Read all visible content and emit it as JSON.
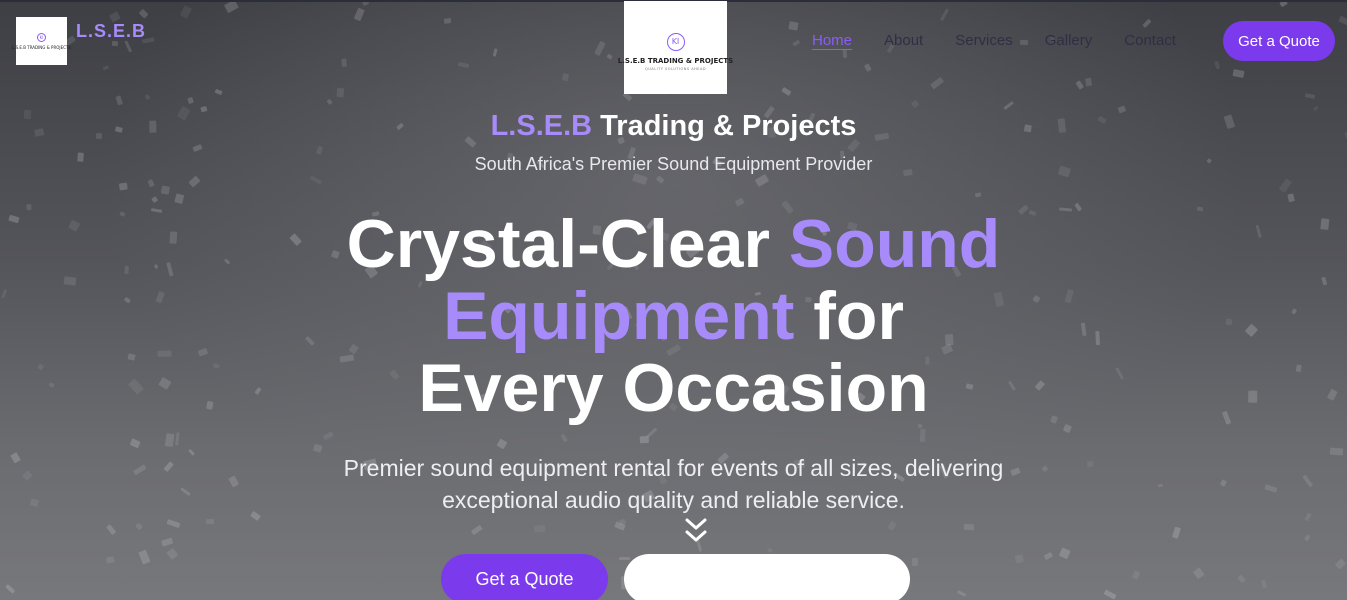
{
  "header": {
    "brand_name": "L.S.E.B",
    "brand_sub": "",
    "brand_logo_text": "L.S.E.B TRADING & PROJECTS",
    "center_logo_title": "L.S.E.B TRADING & PROJECTS",
    "center_logo_sub": "QUALITY SOLUTIONS AHEAD",
    "logo_monogram": "KI",
    "nav": [
      {
        "label": "Home",
        "active": true
      },
      {
        "label": "About",
        "active": false
      },
      {
        "label": "Services",
        "active": false
      },
      {
        "label": "Gallery",
        "active": false
      },
      {
        "label": "Contact",
        "active": false
      }
    ],
    "cta_label": "Get a Quote"
  },
  "hero": {
    "company_accent": "L.S.E.B",
    "company_rest": " Trading & Projects",
    "tagline": "South Africa's Premier Sound Equipment Provider",
    "headline_part1": "Crystal-Clear ",
    "headline_accent1": "Sound",
    "headline_accent2": "Equipment",
    "headline_part2": " for",
    "headline_part3": "Every Occasion",
    "description": "Premier sound equipment rental for events of all sizes, delivering exceptional audio quality and reliable service.",
    "primary_cta": "Get a Quote",
    "secondary_cta": ""
  },
  "colors": {
    "accent": "#a78bfa",
    "brand_purple": "#7c3aed",
    "nav_text": "#2e2f45"
  },
  "icons": {
    "scroll": "chevron-double-down-icon"
  }
}
